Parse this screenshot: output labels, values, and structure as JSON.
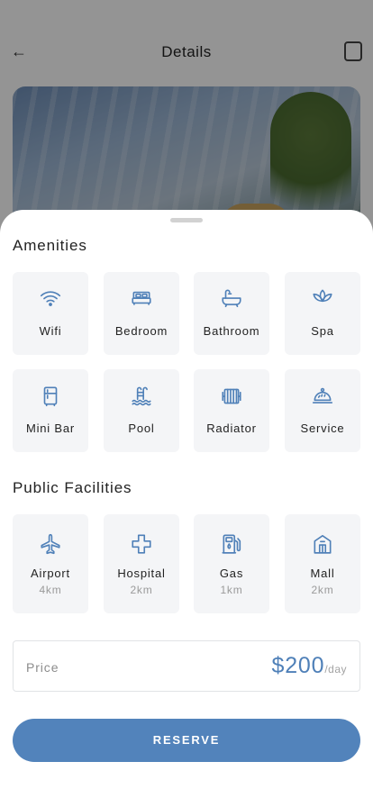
{
  "background_page": {
    "title": "Details"
  },
  "amenities": {
    "title": "Amenities",
    "items": [
      {
        "label": "Wifi",
        "icon": "wifi-icon"
      },
      {
        "label": "Bedroom",
        "icon": "bed-icon"
      },
      {
        "label": "Bathroom",
        "icon": "bathtub-icon"
      },
      {
        "label": "Spa",
        "icon": "spa-icon"
      },
      {
        "label": "Mini Bar",
        "icon": "fridge-icon"
      },
      {
        "label": "Pool",
        "icon": "pool-icon"
      },
      {
        "label": "Radiator",
        "icon": "radiator-icon"
      },
      {
        "label": "Service",
        "icon": "room-service-icon"
      }
    ]
  },
  "public_facilities": {
    "title": "Public Facilities",
    "items": [
      {
        "label": "Airport",
        "distance": "4km",
        "icon": "airplane-icon"
      },
      {
        "label": "Hospital",
        "distance": "2km",
        "icon": "hospital-icon"
      },
      {
        "label": "Gas",
        "distance": "1km",
        "icon": "gas-station-icon"
      },
      {
        "label": "Mall",
        "distance": "2km",
        "icon": "mall-icon"
      }
    ]
  },
  "price": {
    "label": "Price",
    "amount": "$200",
    "unit": "/day"
  },
  "reserve_button": {
    "label": "RESERVE"
  },
  "colors": {
    "accent": "#5283bb",
    "icon": "#4f80b8",
    "tile_background": "#f4f5f7"
  }
}
